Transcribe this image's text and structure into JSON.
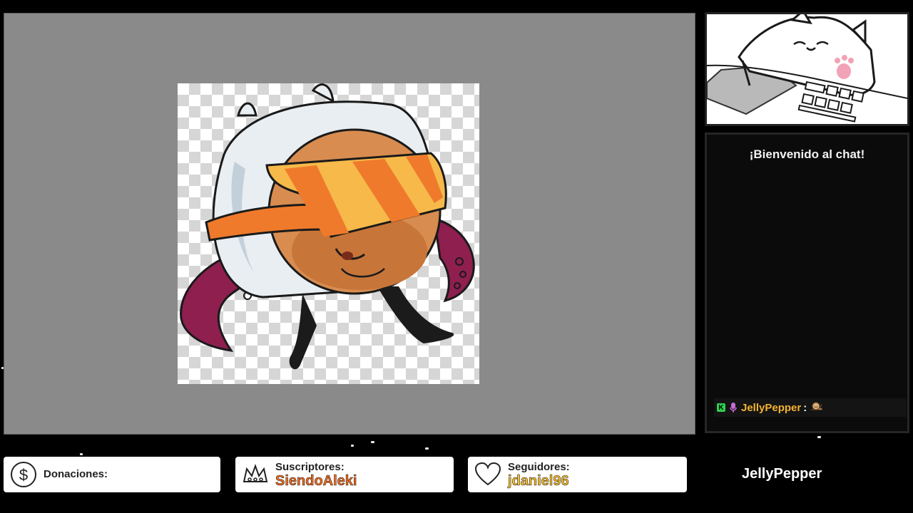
{
  "chat": {
    "title": "¡Bienvenido al chat!",
    "message": {
      "user": "JellyPepper",
      "separator": ":",
      "badge_k": "K",
      "emote": "snail-emote-icon"
    }
  },
  "stats": {
    "donations": {
      "label": "Donaciones:",
      "value": "",
      "icon": "dollar-icon"
    },
    "subscribers": {
      "label": "Suscriptores:",
      "value": "SiendoAleki",
      "icon": "crown-icon"
    },
    "followers": {
      "label": "Seguidores:",
      "value": "jdaniel96",
      "icon": "heart-icon"
    }
  },
  "channel": {
    "name": "JellyPepper"
  },
  "colors": {
    "accent_orange": "#ef6e24",
    "accent_yellow": "#f2c12e",
    "chat_username": "#f4b230",
    "canvas_gray": "#8a8a8a"
  }
}
